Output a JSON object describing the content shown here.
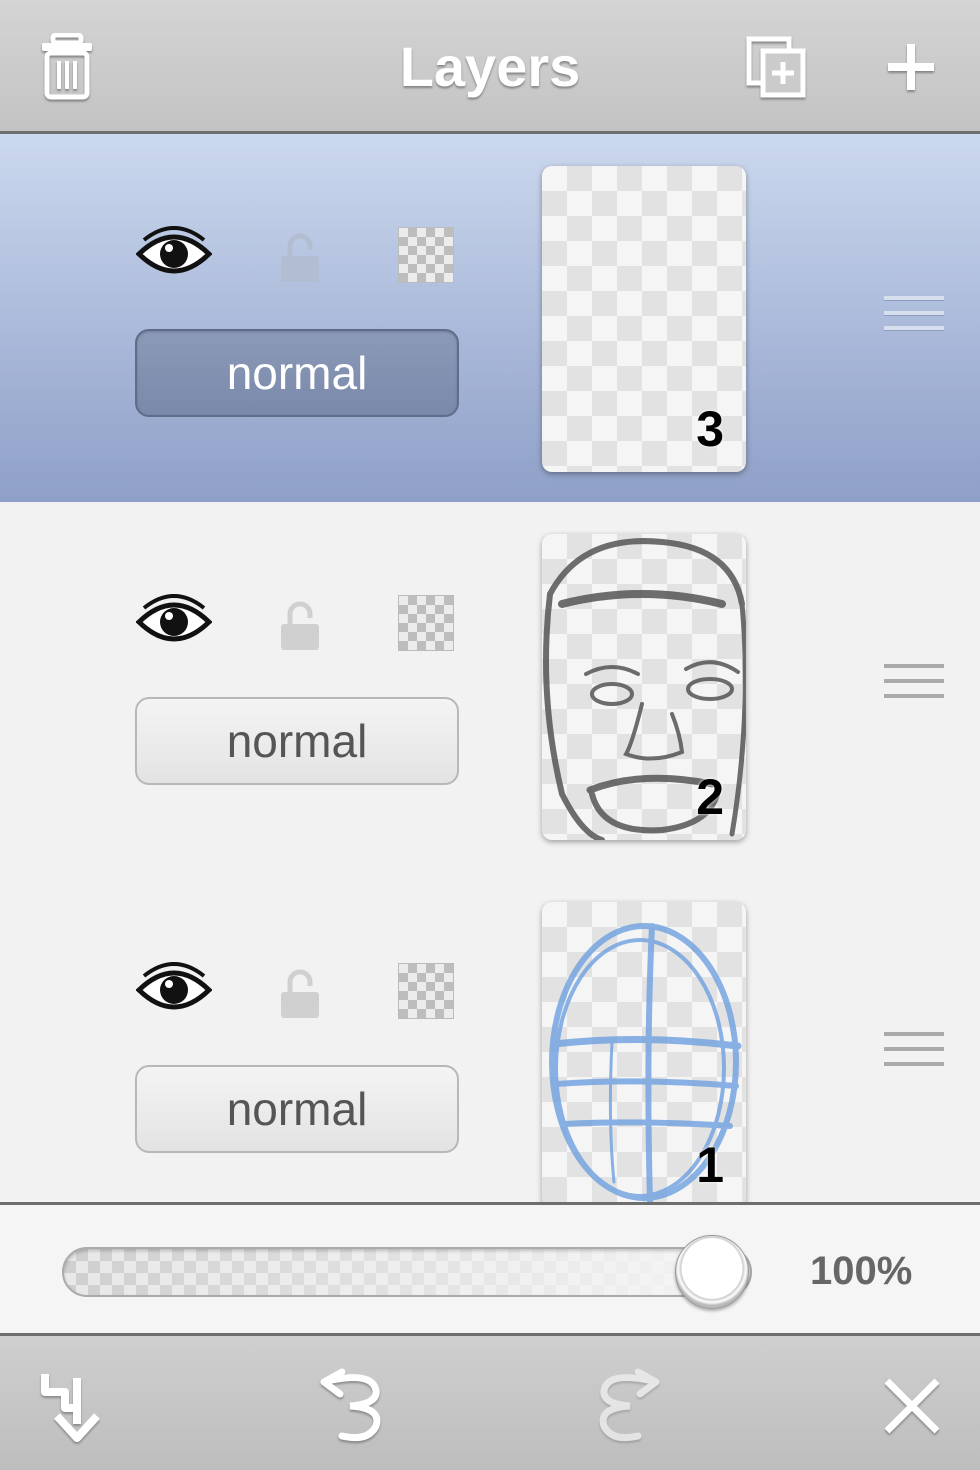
{
  "header": {
    "title": "Layers",
    "delete_icon": "trash-icon",
    "duplicate_icon": "duplicate-layer-icon",
    "add_icon": "plus-icon"
  },
  "layers": [
    {
      "number": "3",
      "blend_mode": "normal",
      "visible": true,
      "locked": false,
      "selected": true
    },
    {
      "number": "2",
      "blend_mode": "normal",
      "visible": true,
      "locked": false,
      "selected": false
    },
    {
      "number": "1",
      "blend_mode": "normal",
      "visible": true,
      "locked": false,
      "selected": false
    }
  ],
  "opacity": {
    "value_label": "100%",
    "value": 1.0
  },
  "footer": {
    "merge_down_icon": "merge-down-icon",
    "undo_icon": "undo-icon",
    "redo_icon": "redo-icon",
    "close_icon": "close-icon"
  },
  "colors": {
    "selected_row_top": "#cbd8ee",
    "selected_row_bottom": "#8e9fc8",
    "sketch_blue": "#6fa0e0"
  }
}
